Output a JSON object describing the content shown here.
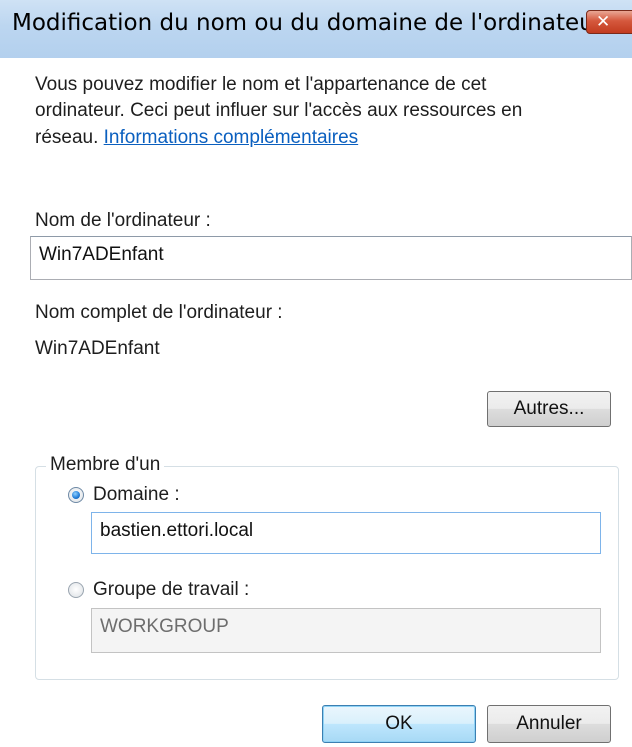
{
  "window": {
    "title": "Modification du nom ou du domaine de l'ordinateur",
    "close_label": "✕"
  },
  "intro": {
    "line1": "Vous pouvez modifier le nom et l'appartenance de cet",
    "line2": "ordinateur. Ceci peut influer sur l'accès aux ressources en",
    "line3_prefix": "réseau. ",
    "link": "Informations complémentaires"
  },
  "computer_name": {
    "label": "Nom de l'ordinateur :",
    "value": "Win7ADEnfant"
  },
  "full_name": {
    "label": "Nom complet de l'ordinateur :",
    "value": "Win7ADEnfant"
  },
  "buttons": {
    "more": "Autres...",
    "ok": "OK",
    "cancel": "Annuler"
  },
  "member_of": {
    "legend": "Membre d'un",
    "domain": {
      "label": "Domaine :",
      "value": "bastien.ettori.local",
      "selected": true
    },
    "workgroup": {
      "label": "Groupe de travail :",
      "value": "WORKGROUP",
      "selected": false
    }
  }
}
